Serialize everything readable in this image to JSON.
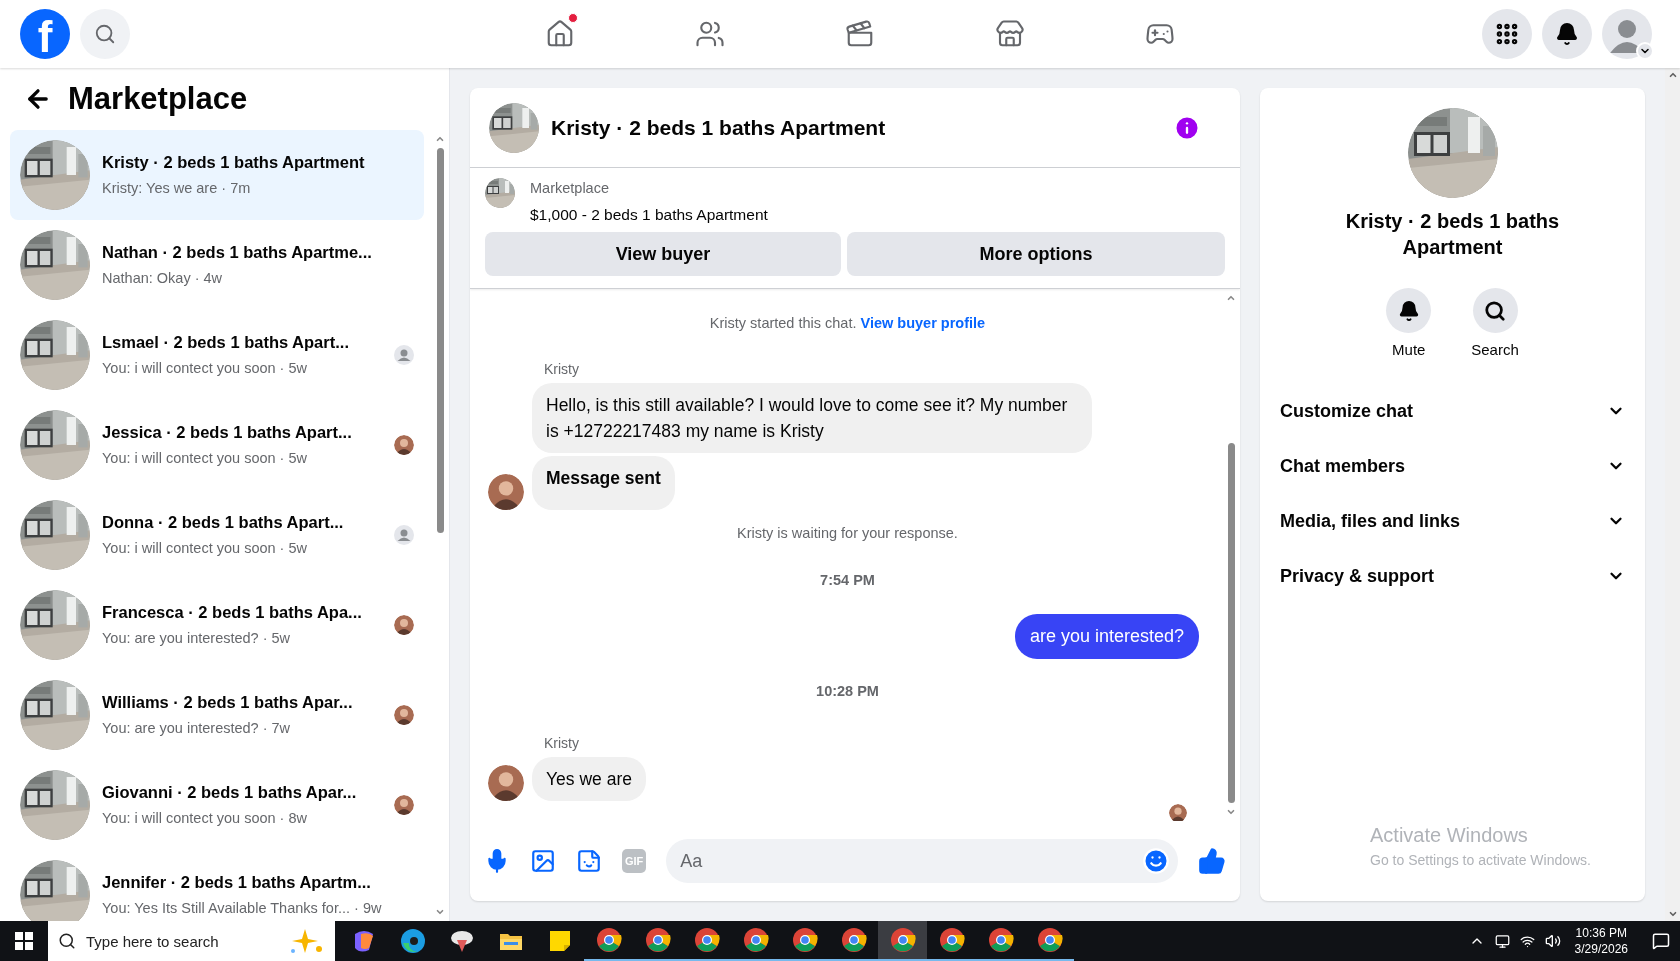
{
  "topbar": {
    "logo": "f",
    "nav": [
      {
        "kind": "home",
        "selected": false,
        "badge": true
      },
      {
        "kind": "friends",
        "selected": false,
        "badge": false
      },
      {
        "kind": "video",
        "selected": false,
        "badge": false
      },
      {
        "kind": "marketplace",
        "selected": false,
        "badge": false
      },
      {
        "kind": "gaming",
        "selected": false,
        "badge": false
      }
    ]
  },
  "sidebar": {
    "title": "Marketplace",
    "conversations": [
      {
        "title": "Kristy · 2 beds 1 baths Apartment",
        "preview": "Kristy: Yes we are · 7m",
        "selected": true
      },
      {
        "title": "Nathan · 2 beds 1 baths Apartme...",
        "preview": "Nathan: Okay · 4w",
        "selected": false
      },
      {
        "title": "Lsmael · 2 beds 1 baths Apart...",
        "preview": "You: i will contect you soon · 5w",
        "selected": false,
        "seen": {
          "kind": "generic"
        }
      },
      {
        "title": "Jessica · 2 beds 1 baths Apart...",
        "preview": "You: i will contect you soon · 5w",
        "selected": false
      },
      {
        "title": "Donna · 2 beds 1 baths Apart...",
        "preview": "You: i will contect you soon · 5w",
        "selected": false,
        "seen": {
          "kind": "generic"
        }
      },
      {
        "title": "Francesca · 2 beds 1 baths Apa...",
        "preview": "You: are you interested? · 5w",
        "selected": false
      },
      {
        "title": "Williams · 2 beds 1 baths Apar...",
        "preview": "You: are you interested? · 7w",
        "selected": false
      },
      {
        "title": "Giovanni · 2 beds 1 baths Apar...",
        "preview": "You: i will contect you soon · 8w",
        "selected": false
      },
      {
        "title": "Jennifer · 2 beds 1 baths Apartm...",
        "preview": "You: Yes Its Still Available Thanks for... · 9w",
        "selected": false
      }
    ]
  },
  "chat": {
    "title": "Kristy · 2 beds 1 baths Apartment",
    "listing": {
      "source": "Marketplace",
      "title": "$1,000 - 2 beds 1 baths Apartment"
    },
    "buttons": [
      "View buyer",
      "More options"
    ],
    "messages": [
      {
        "kind": "system",
        "text": "Kristy started this chat.",
        "link": "View buyer profile"
      },
      {
        "kind": "sender",
        "text": "Kristy"
      },
      {
        "kind": "incoming",
        "text": "Hello, is this still available? I would love to come see it? My number is +12722217483 my name is Kristy",
        "avatar": false,
        "bold": false
      },
      {
        "kind": "incoming",
        "text": "Message sent",
        "avatar": true,
        "bold": true
      },
      {
        "kind": "system",
        "text": "Kristy is waiting for your response."
      },
      {
        "kind": "time",
        "text": "7:54 PM"
      },
      {
        "kind": "outgoing",
        "text": "are you interested?"
      },
      {
        "kind": "time",
        "text": "10:28 PM"
      },
      {
        "kind": "sender",
        "text": "Kristy"
      },
      {
        "kind": "incoming",
        "text": "Yes we are",
        "avatar": true,
        "bold": false
      },
      {
        "kind": "receipt"
      }
    ],
    "composer": {
      "placeholder": "Aa",
      "gif_label": "GIF"
    }
  },
  "details": {
    "title": "Kristy · 2 beds 1 baths Apartment",
    "actions": [
      {
        "kind": "mute",
        "label": "Mute"
      },
      {
        "kind": "search",
        "label": "Search"
      }
    ],
    "sections": [
      {
        "label": "Customize chat",
        "expanded": false
      },
      {
        "label": "Chat members",
        "expanded": false
      },
      {
        "label": "Media, files and links",
        "expanded": false
      },
      {
        "label": "Privacy & support",
        "expanded": false
      }
    ],
    "notice": {
      "title": "Activate Windows",
      "text": "Go to Settings to activate Windows."
    }
  },
  "taskbar": {
    "search_placeholder": "Type here to search",
    "apps": [
      {
        "kind": "copilot",
        "selected": false
      },
      {
        "kind": "edge",
        "selected": false
      },
      {
        "kind": "app",
        "selected": false
      },
      {
        "kind": "explorer",
        "selected": false
      },
      {
        "kind": "notes",
        "selected": false
      },
      {
        "kind": "chrome",
        "selected": false
      },
      {
        "kind": "chrome",
        "selected": false
      },
      {
        "kind": "chrome",
        "selected": false
      },
      {
        "kind": "chrome",
        "selected": false
      },
      {
        "kind": "chrome",
        "selected": false
      },
      {
        "kind": "chrome",
        "selected": false
      },
      {
        "kind": "chrome",
        "selected": true
      },
      {
        "kind": "chrome",
        "selected": false
      },
      {
        "kind": "chrome",
        "selected": false
      },
      {
        "kind": "chrome",
        "selected": false
      }
    ],
    "time": "10:36 PM",
    "date": "3/29/2026"
  }
}
